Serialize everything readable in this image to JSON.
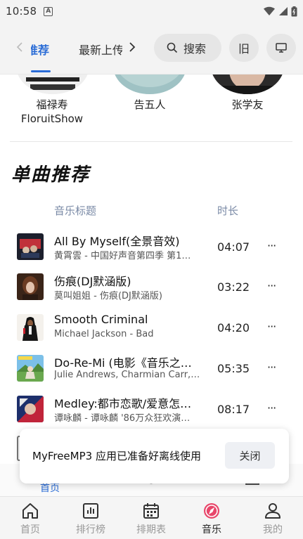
{
  "status": {
    "time": "10:58",
    "notif_letter": "A"
  },
  "tabs": [
    {
      "label": "推荐"
    },
    {
      "label": "最新上传"
    }
  ],
  "search": {
    "label": "搜索"
  },
  "old_button": {
    "label": "旧"
  },
  "artists": [
    {
      "name": "福禄寿 FloruitShow"
    },
    {
      "name": "告五人"
    },
    {
      "name": "张学友"
    }
  ],
  "section": {
    "title": "单曲推荐",
    "col_title": "音乐标题",
    "col_duration": "时长"
  },
  "songs": [
    {
      "title": "All By Myself(全景音效)",
      "subtitle": "黄霄雲 - 中国好声音第四季 第1…",
      "duration": "04:07",
      "more": "···"
    },
    {
      "title": "伤痕(DJ默涵版)",
      "subtitle": "莫叫姐姐 - 伤痕(DJ默涵版)",
      "duration": "03:22",
      "more": "···"
    },
    {
      "title": "Smooth Criminal",
      "subtitle": "Michael Jackson - Bad",
      "duration": "04:20",
      "more": "···"
    },
    {
      "title": "Do-Re-Mi (电影《音乐之…",
      "subtitle": "Julie Andrews, Charmian Carr,…",
      "duration": "05:35",
      "more": "···"
    },
    {
      "title": "Medley:都市恋歌/爱意怎…",
      "subtitle": "谭咏麟 - 谭咏麟 '86万众狂欢演…",
      "duration": "08:17",
      "more": "···"
    }
  ],
  "toast": {
    "message": "MyFreeMP3 应用已准备好离线使用",
    "close": "关闭"
  },
  "subnav": {
    "home": "首页"
  },
  "bottom_nav": [
    {
      "label": "首页",
      "icon": "home-icon"
    },
    {
      "label": "排行榜",
      "icon": "chart-icon"
    },
    {
      "label": "排期表",
      "icon": "calendar-icon"
    },
    {
      "label": "音乐",
      "icon": "compass-icon",
      "active": true
    },
    {
      "label": "我的",
      "icon": "person-icon"
    }
  ],
  "colors": {
    "accent": "#2a6cd6",
    "music_icon": "#e8466a"
  }
}
